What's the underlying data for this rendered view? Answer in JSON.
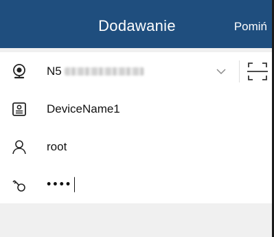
{
  "header": {
    "title": "Dodawanie",
    "skip_label": "Pomiń",
    "bg_color": "#1f4e7e"
  },
  "form": {
    "serial": {
      "icon": "camera-icon",
      "value_prefix": "N5",
      "value_blurred": true
    },
    "device_name": {
      "icon": "device-card-icon",
      "value": "DeviceName1"
    },
    "username": {
      "icon": "user-icon",
      "value": "root"
    },
    "password": {
      "icon": "key-icon",
      "masked_value": "••••"
    }
  },
  "icons": {
    "dropdown": "chevron-down-icon",
    "scan": "qr-scan-icon"
  }
}
